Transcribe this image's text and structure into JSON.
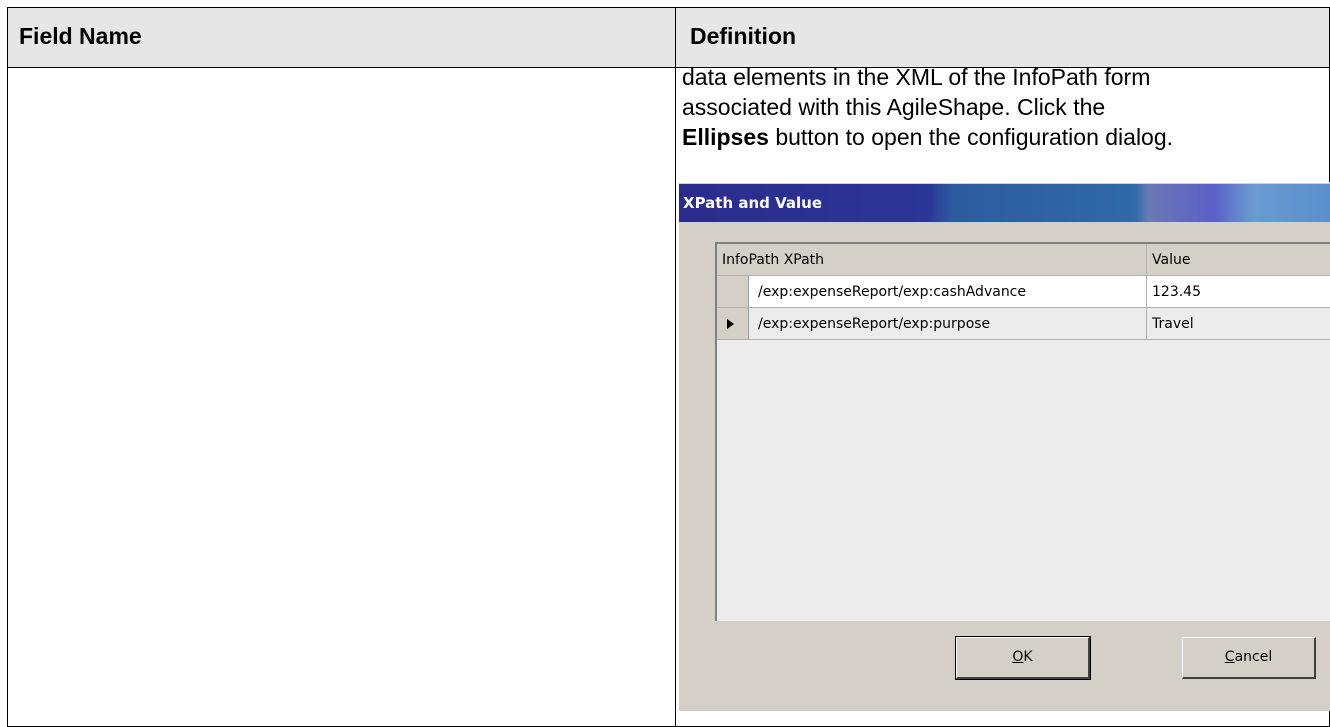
{
  "table": {
    "headers": [
      "Field Name",
      "Definition"
    ],
    "definition_text": {
      "line1": "data elements in the XML of the InfoPath form",
      "line2": "associated with this AgileShape. Click the",
      "bold_word": "Ellipses",
      "line3_rest": " button to open the configuration dialog."
    }
  },
  "dialog": {
    "title": "XPath and Value",
    "columns": [
      "InfoPath XPath",
      "Value"
    ],
    "rows": [
      {
        "xpath": "/exp:expenseReport/exp:cashAdvance",
        "value": "123.45",
        "selected": false
      },
      {
        "xpath": "/exp:expenseReport/exp:purpose",
        "value": "Travel",
        "selected": true
      }
    ],
    "buttons": {
      "ok": {
        "mnemonic": "O",
        "rest": "K"
      },
      "cancel": {
        "mnemonic": "C",
        "rest": "ancel"
      }
    }
  }
}
